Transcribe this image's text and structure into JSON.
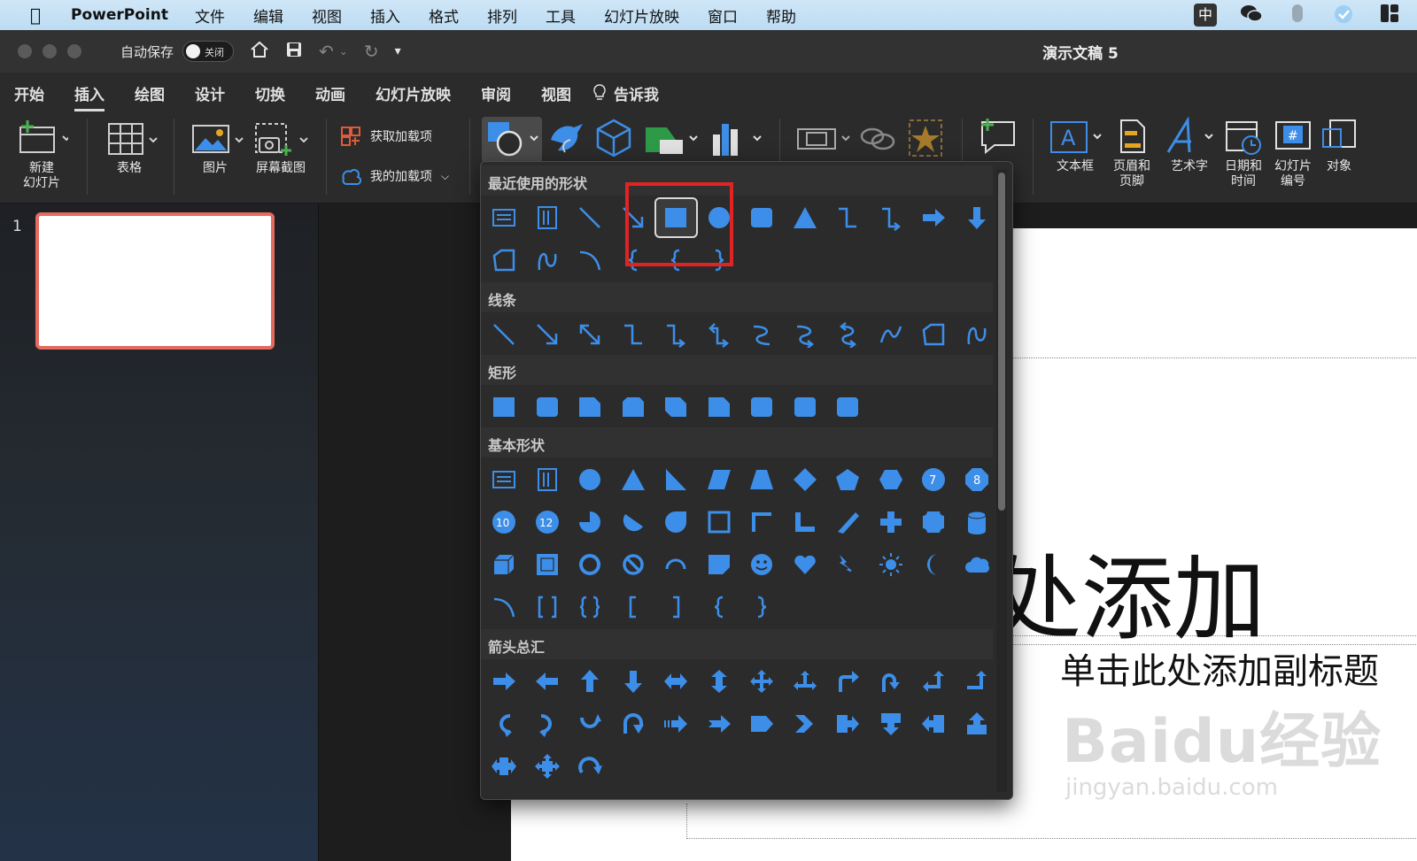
{
  "menubar": {
    "app_name": "PowerPoint",
    "items": [
      "文件",
      "编辑",
      "视图",
      "插入",
      "格式",
      "排列",
      "工具",
      "幻灯片放映",
      "窗口",
      "帮助"
    ],
    "status_icons": [
      "input-method-icon",
      "wechat-icon",
      "mouse-icon",
      "app-icon",
      "layout-icon"
    ],
    "input_method_label": "中"
  },
  "titlebar": {
    "autosave_label": "自动保存",
    "autosave_state": "关闭",
    "document_title": "演示文稿 5"
  },
  "ribbon_tabs": {
    "items": [
      "开始",
      "插入",
      "绘图",
      "设计",
      "切换",
      "动画",
      "幻灯片放映",
      "审阅",
      "视图"
    ],
    "active": "插入",
    "tell_me": "告诉我"
  },
  "ribbon": {
    "new_slide": "新建\n幻灯片",
    "table": "表格",
    "picture": "图片",
    "screenshot": "屏幕截图",
    "get_addins": "获取加载项",
    "my_addins": "我的加载项",
    "textbox": "文本框",
    "header_footer": "页眉和\n页脚",
    "wordart": "艺术字",
    "date_time": "日期和\n时间",
    "slide_number": "幻灯片\n编号",
    "object": "对象"
  },
  "thumbnails": {
    "slide_number": "1"
  },
  "slide": {
    "title_placeholder": "击此处添加",
    "subtitle_placeholder": "单击此处添加副标题"
  },
  "watermark": {
    "logo": "Baidu经验",
    "url": "jingyan.baidu.com"
  },
  "shapes_gallery": {
    "sections": [
      "最近使用的形状",
      "线条",
      "矩形",
      "基本形状",
      "箭头总汇"
    ],
    "selected_shape": "rectangle",
    "accent_color": "#3d8ee8",
    "highlight_color": "#e02424"
  }
}
